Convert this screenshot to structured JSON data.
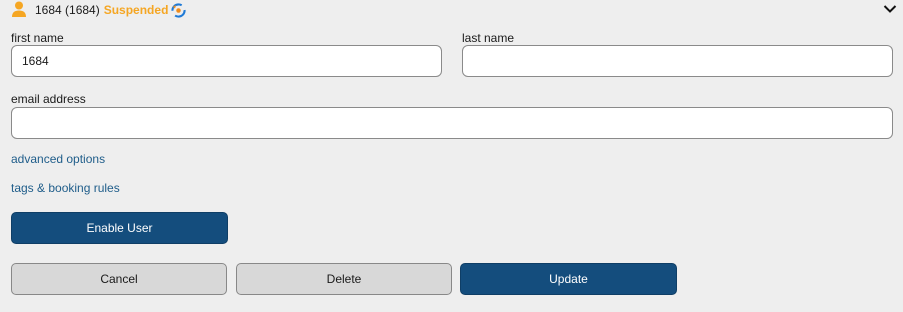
{
  "header": {
    "title": "1684 (1684)",
    "status": "Suspended",
    "status_color": "#f5a623",
    "user_icon": "user-icon",
    "status_icon": "sync-status-icon",
    "expand_icon": "chevron-down-icon"
  },
  "form": {
    "first_name_label": "first name",
    "first_name_value": "1684",
    "last_name_label": "last name",
    "last_name_value": "",
    "email_label": "email address",
    "email_value": ""
  },
  "links": {
    "advanced_options": "advanced options",
    "tags_booking_rules": "tags & booking rules"
  },
  "buttons": {
    "enable_user": "Enable User",
    "cancel": "Cancel",
    "delete": "Delete",
    "update": "Update"
  },
  "colors": {
    "primary": "#144d7d",
    "link": "#1f5d8a",
    "accent": "#f5a623"
  }
}
